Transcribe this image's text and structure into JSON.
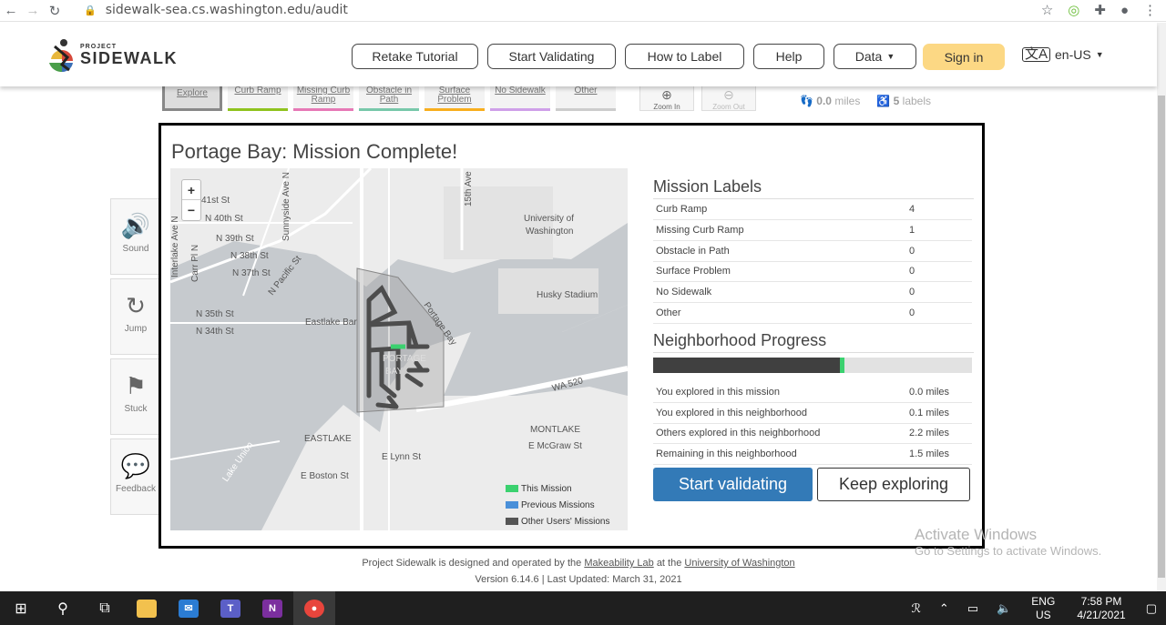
{
  "browser": {
    "url": "sidewalk-sea.cs.washington.edu/audit"
  },
  "site": {
    "logo_small": "PROJECT",
    "logo_big": "SIDEWALK",
    "nav_buttons": [
      "Retake Tutorial",
      "Start Validating",
      "How to Label",
      "Help",
      "Data"
    ],
    "sign_in": "Sign in",
    "language": "en-US"
  },
  "audit": {
    "tools": [
      "Explore",
      "Curb Ramp",
      "Missing Curb Ramp",
      "Obstacle in Path",
      "Surface Problem",
      "No Sidewalk",
      "Other"
    ],
    "tool_colors": [
      "#888888",
      "#90c31f",
      "#e679b6",
      "#78c8aa",
      "#f8ae1e",
      "#cfa0e9",
      "#cccccc"
    ],
    "zoom_in": "Zoom In",
    "zoom_out": "Zoom Out",
    "distance_value": "0.0",
    "distance_unit": "miles",
    "labels_value": "5",
    "labels_unit": "labels",
    "side_tools": [
      {
        "label": "Sound",
        "icon": "speaker-icon"
      },
      {
        "label": "Jump",
        "icon": "jump-icon"
      },
      {
        "label": "Stuck",
        "icon": "stuck-icon"
      },
      {
        "label": "Feedback",
        "icon": "feedback-icon"
      }
    ]
  },
  "modal": {
    "title": "Portage Bay: Mission Complete!",
    "map": {
      "zoom_in": "+",
      "zoom_out": "−",
      "labels": [
        "41st St",
        "N 40th St",
        "N 39th St",
        "N 38th St",
        "N 37th St",
        "N 35th St",
        "N 34th St",
        "Sunnyside Ave N",
        "Interlake Ave N",
        "Carr Pl N",
        "N Pacific St",
        "15th Ave",
        "University of",
        "Washington",
        "Husky Stadium",
        "Portage Bay",
        "Eastlake Bar",
        "PORTAGE",
        "BAY",
        "WA 520",
        "MONTLAKE",
        "E McGraw St",
        "EASTLAKE",
        "E Lynn St",
        "E Boston St",
        "Lake Union"
      ],
      "legend": [
        {
          "label": "This Mission",
          "color": "#3bd16f"
        },
        {
          "label": "Previous Missions",
          "color": "#4a90d9"
        },
        {
          "label": "Other Users' Missions",
          "color": "#555555"
        }
      ]
    },
    "mission_labels_title": "Mission Labels",
    "mission_labels": [
      {
        "name": "Curb Ramp",
        "value": "4"
      },
      {
        "name": "Missing Curb Ramp",
        "value": "1"
      },
      {
        "name": "Obstacle in Path",
        "value": "0"
      },
      {
        "name": "Surface Problem",
        "value": "0"
      },
      {
        "name": "No Sidewalk",
        "value": "0"
      },
      {
        "name": "Other",
        "value": "0"
      }
    ],
    "progress_title": "Neighborhood Progress",
    "progress": {
      "explored_fraction": 0.585,
      "mission_fraction": 0.015
    },
    "progress_rows": [
      {
        "name": "You explored in this mission",
        "value": "0.0 miles"
      },
      {
        "name": "You explored in this neighborhood",
        "value": "0.1 miles"
      },
      {
        "name": "Others explored in this neighborhood",
        "value": "2.2 miles"
      },
      {
        "name": "Remaining in this neighborhood",
        "value": "1.5 miles"
      }
    ],
    "start_validating": "Start validating",
    "keep_exploring": "Keep exploring"
  },
  "footer": {
    "line1_pre": "Project Sidewalk is designed and operated by the",
    "lab": "Makeability Lab",
    "line1_mid": "at the",
    "university": "University of Washington",
    "line2": "Version 6.14.6 | Last Updated: March 31, 2021"
  },
  "watermark": {
    "line1": "Activate Windows",
    "line2": "Go to Settings to activate Windows."
  },
  "taskbar": {
    "lang_top": "ENG",
    "lang_bottom": "US",
    "time": "7:58 PM",
    "date": "4/21/2021"
  }
}
